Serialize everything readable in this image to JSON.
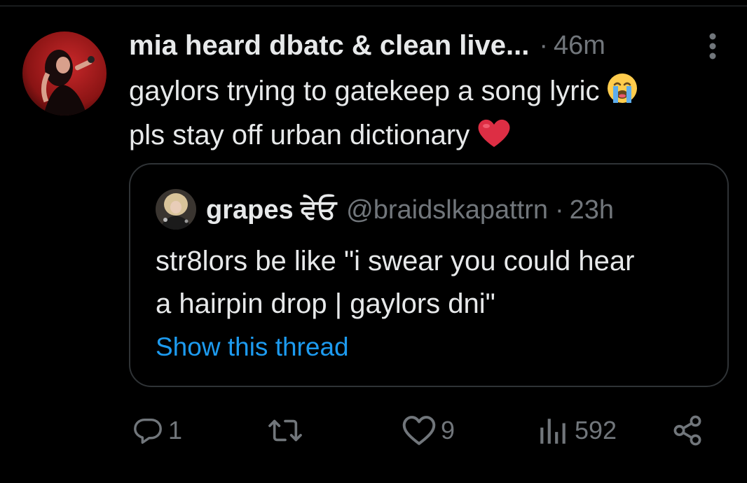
{
  "tweet": {
    "display_name": "mia heard dbatc & clean live...",
    "separator": "·",
    "timestamp": "46m",
    "text_line1": "gaylors trying to gatekeep a song lyric",
    "text_line2": "pls stay off urban dictionary",
    "emoji1": "loudly-crying-face",
    "emoji2": "red-heart"
  },
  "quote": {
    "display_name": "grapes ਵੇਓ",
    "handle": "@braidslkapattrn",
    "separator": "·",
    "timestamp": "23h",
    "text_line1": "str8lors be like \"i swear you could hear",
    "text_line2": "a hairpin drop | gaylors dni\"",
    "show_thread": "Show this thread"
  },
  "actions": {
    "replies": "1",
    "likes": "9",
    "views": "592"
  },
  "colors": {
    "background": "#000000",
    "text": "#e7e9ea",
    "muted": "#71767b",
    "border": "#2f3336",
    "link": "#1d9bf0"
  }
}
